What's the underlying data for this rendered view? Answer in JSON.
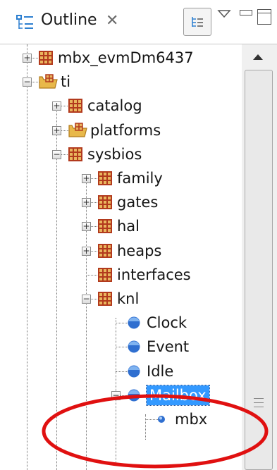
{
  "header": {
    "title": "Outline",
    "close_glyph": "✕",
    "buttons": [
      "sort-button",
      "view-menu",
      "minimize",
      "maximize"
    ]
  },
  "tree": [
    {
      "label": "mbx_evmDm6437",
      "type": "package",
      "expanded": false
    },
    {
      "label": "ti",
      "type": "folder",
      "expanded": true
    },
    {
      "label": "catalog",
      "type": "package",
      "expanded": false
    },
    {
      "label": "platforms",
      "type": "folder",
      "expanded": false
    },
    {
      "label": "sysbios",
      "type": "package",
      "expanded": true
    },
    {
      "label": "family",
      "type": "package",
      "expanded": false
    },
    {
      "label": "gates",
      "type": "package",
      "expanded": false
    },
    {
      "label": "hal",
      "type": "package",
      "expanded": false
    },
    {
      "label": "heaps",
      "type": "package",
      "expanded": false
    },
    {
      "label": "interfaces",
      "type": "package",
      "expanded": null
    },
    {
      "label": "knl",
      "type": "package",
      "expanded": true
    },
    {
      "label": "Clock",
      "type": "class",
      "expanded": null
    },
    {
      "label": "Event",
      "type": "class",
      "expanded": null
    },
    {
      "label": "Idle",
      "type": "class",
      "expanded": null
    },
    {
      "label": "Mailbox",
      "type": "class",
      "expanded": true,
      "selected": true
    },
    {
      "label": "mbx",
      "type": "field",
      "expanded": null
    }
  ],
  "colors": {
    "package": "#b23a1d",
    "folder": "#e8b84a",
    "class": "#2f6fd0",
    "selection": "#3399ff",
    "annotation": "#e01010"
  }
}
